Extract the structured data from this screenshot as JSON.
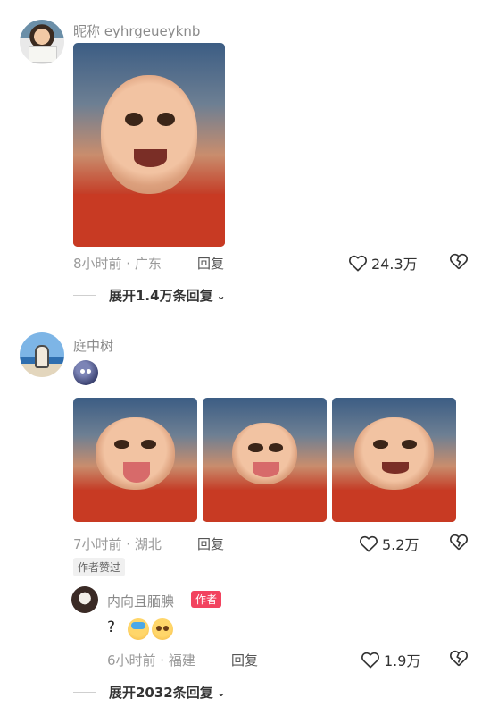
{
  "comment1": {
    "username": "昵称 eyhrgeueyknb",
    "meta": "8小时前 · 广东",
    "reply_label": "回复",
    "likes": "24.3万",
    "expand": "展开1.4万条回复"
  },
  "comment2": {
    "username": "庭中树",
    "meta": "7小时前 · 湖北",
    "reply_label": "回复",
    "likes": "5.2万",
    "author_liked": "作者赞过"
  },
  "reply": {
    "username": "内向且腼腆",
    "author_badge": "作者",
    "text": "?",
    "meta": "6小时前 · 福建",
    "reply_label": "回复",
    "likes": "1.9万",
    "expand": "展开2032条回复"
  },
  "icons": {
    "like": "heart-icon",
    "dislike": "broken-heart-icon",
    "expand": "chevron-down-icon"
  },
  "colors": {
    "author_badge": "#f2435f",
    "meta_text": "#9a9a9a"
  }
}
